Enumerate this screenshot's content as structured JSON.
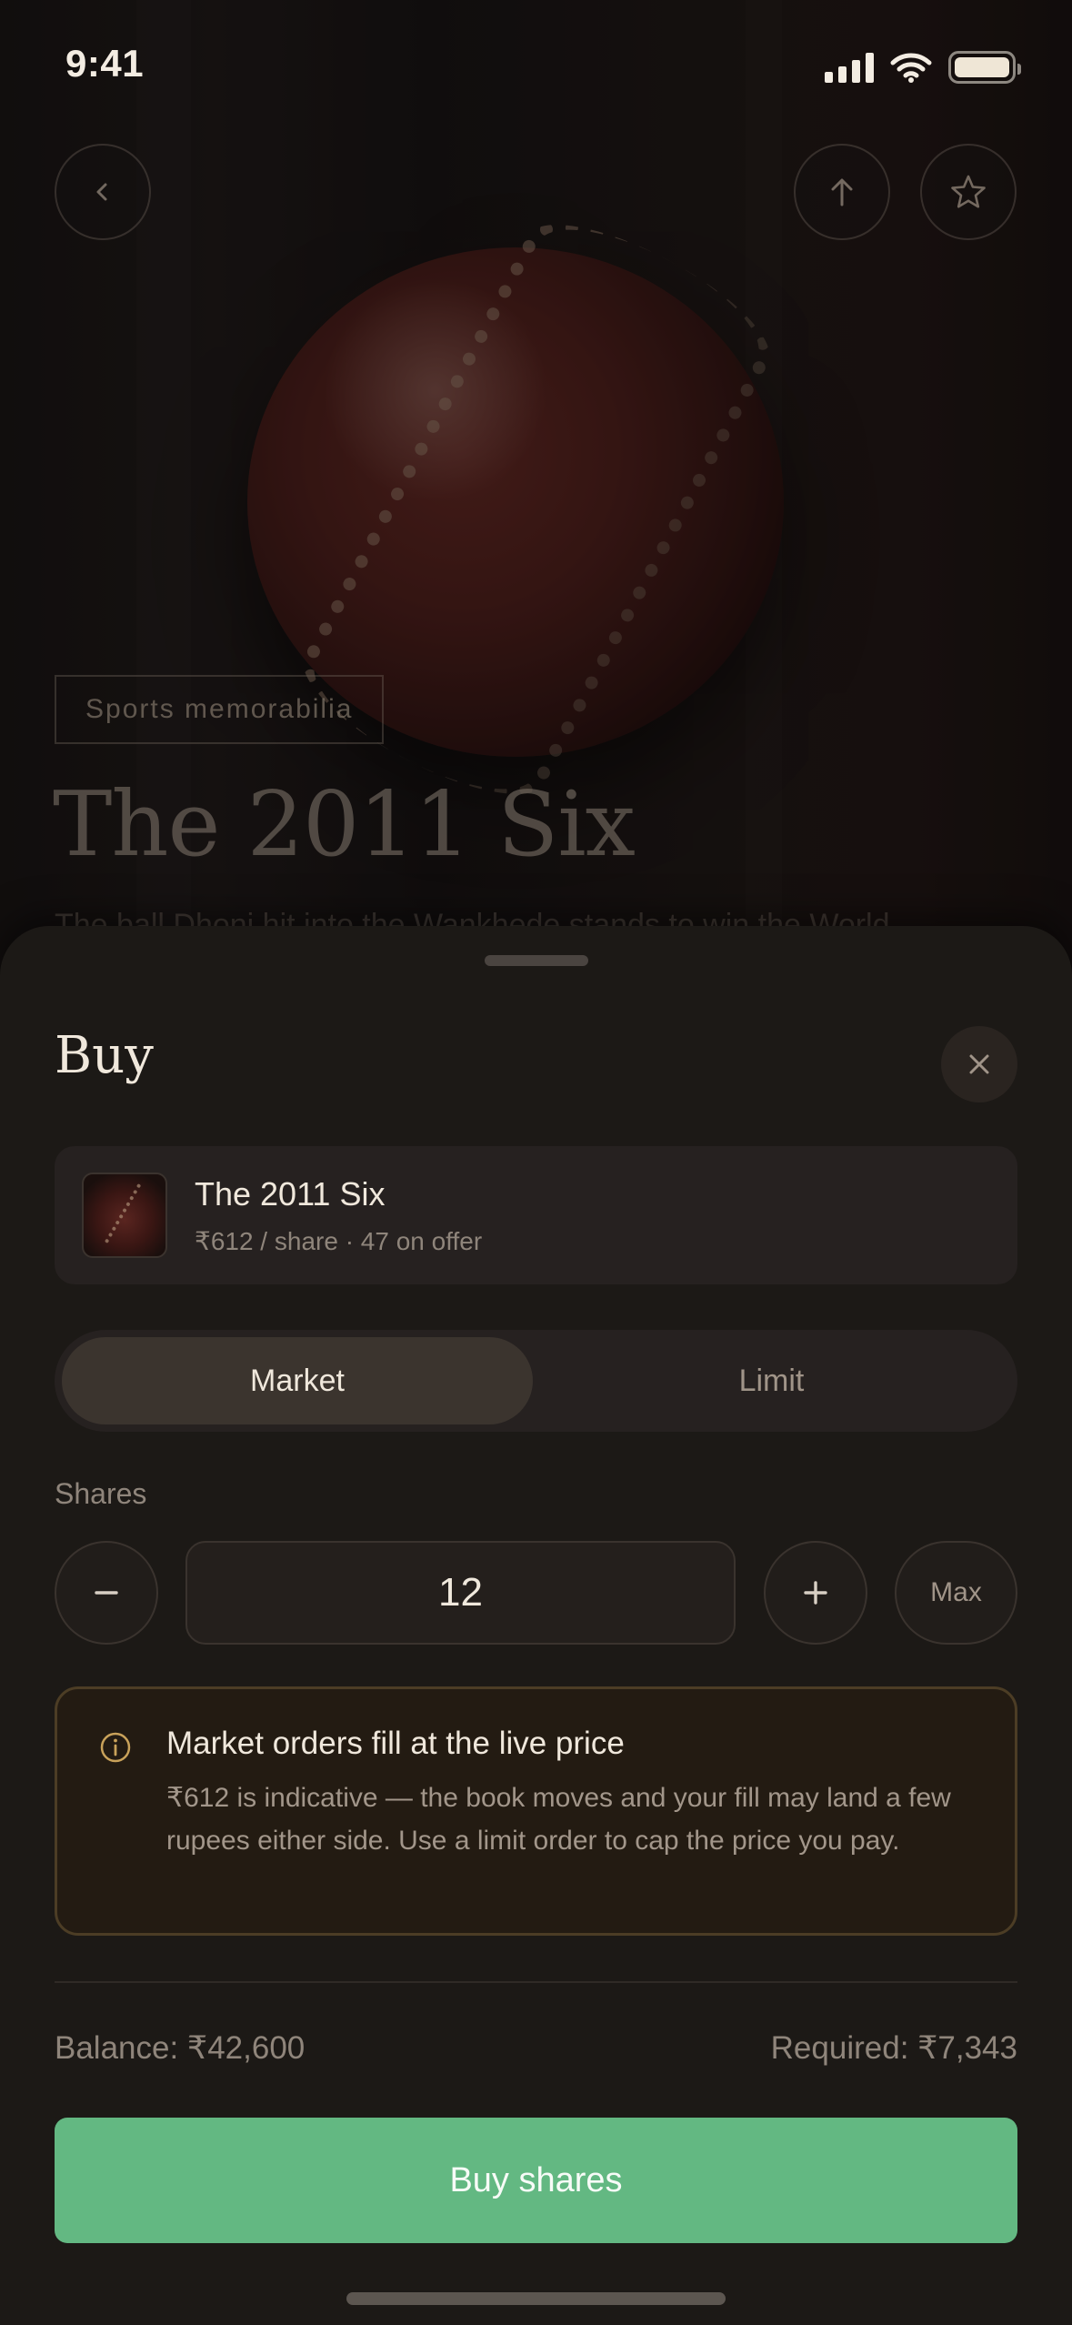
{
  "status_bar": {
    "time": "9:41"
  },
  "hero": {
    "category": "Sports memorabilia",
    "title": "The 2011 Six",
    "description": "The ball Dhoni hit into the Wankhede stands to win the World"
  },
  "sheet": {
    "title": "Buy",
    "asset": {
      "name": "The 2011 Six",
      "subtitle": "₹612 / share · 47 on offer"
    },
    "order_types": [
      "Market",
      "Limit"
    ],
    "selected_order_type": "Market",
    "shares_label": "Shares",
    "quantity": "12",
    "max_label": "Max",
    "notice": {
      "title": "Market orders fill at the live price",
      "body": "₹612 is indicative — the book moves and your fill may land a few rupees either side. Use a limit order to cap the price you pay."
    },
    "balance": "Balance: ₹42,600",
    "required": "Required: ₹7,343",
    "buy_button": "Buy shares"
  },
  "colors": {
    "accent_green": "#63b882",
    "notice_border": "#4c3d25",
    "notice_icon": "#c9a25a"
  },
  "icons": [
    "back-chevron-icon",
    "share-icon",
    "star-icon",
    "close-icon",
    "minus-icon",
    "plus-icon",
    "info-icon"
  ]
}
